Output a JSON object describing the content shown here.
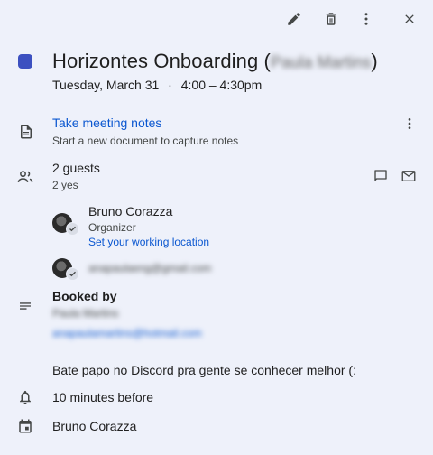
{
  "toolbar": {
    "edit_icon": "pencil-icon",
    "delete_icon": "trash-icon",
    "more_icon": "more-vert-icon",
    "close_icon": "close-icon"
  },
  "event": {
    "color": "#3c50c0",
    "title_prefix": "Horizontes Onboarding (",
    "title_hidden_name": "Paula Martins",
    "title_suffix": ")",
    "date": "Tuesday, March 31",
    "separator": "·",
    "time": "4:00 – 4:30pm"
  },
  "notes": {
    "title": "Take meeting notes",
    "subtitle": "Start a new document to capture notes"
  },
  "guests": {
    "count_label": "2 guests",
    "rsvp_label": "2 yes",
    "people": [
      {
        "name": "Bruno Corazza",
        "role": "Organizer",
        "action": "Set your working location"
      },
      {
        "email_hidden": "anapaulaeng@gmail.com"
      }
    ]
  },
  "description": {
    "heading": "Booked by",
    "booker_name_hidden": "Paula Martins",
    "booker_email_hidden": "anapaulamartins@hotmail.com",
    "body": "Bate papo no Discord pra gente se conhecer melhor (:"
  },
  "reminder": {
    "label": "10 minutes before"
  },
  "calendar": {
    "owner": "Bruno Corazza"
  }
}
